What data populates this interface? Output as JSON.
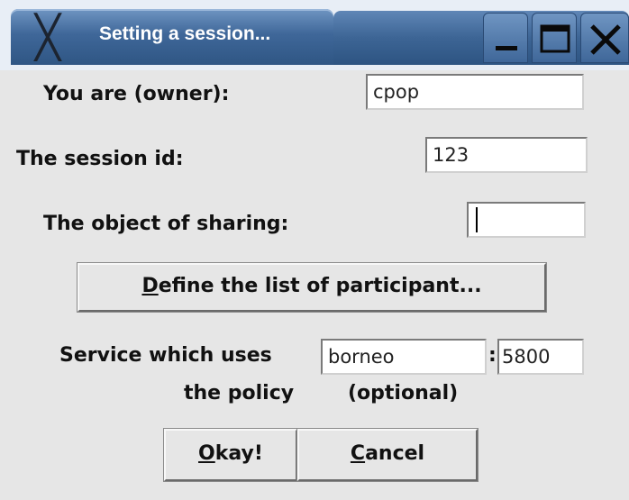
{
  "window": {
    "title": "Setting a session..."
  },
  "form": {
    "owner_label": "You  are (owner):",
    "owner_value": "cpop",
    "session_label": "The session id:",
    "session_value": "123",
    "object_label": "The object of sharing:",
    "object_value": "",
    "define_button_accel": "D",
    "define_button_rest": "efine the list of  participant...",
    "service_label": "Service which uses",
    "service_host": "borneo",
    "service_sep": ":",
    "service_port": "5800",
    "policy_label": "the policy",
    "optional_label": "(optional)"
  },
  "buttons": {
    "okay_accel": "O",
    "okay_rest": "kay!",
    "cancel_accel": "C",
    "cancel_rest": "ancel"
  },
  "icons": {
    "app": "x-window-logo",
    "minimize": "minimize-icon",
    "maximize": "maximize-icon",
    "close": "close-icon"
  }
}
